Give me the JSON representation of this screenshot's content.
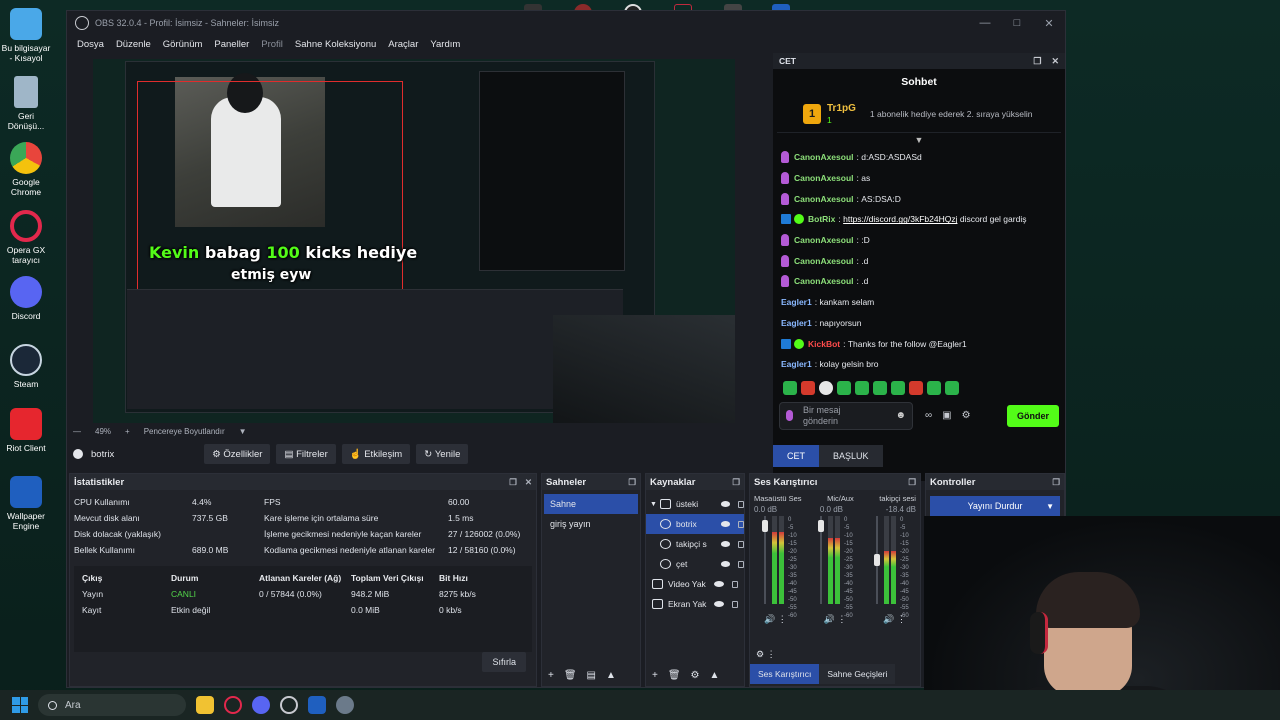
{
  "desktop": {
    "icons": [
      {
        "label": "Bu bilgisayar - Kısayol",
        "icon": "computer-icon",
        "color": "#4aa8e8"
      },
      {
        "label": "Geri Dönüşü...",
        "icon": "recycle-bin-icon",
        "color": "#9fb6c8"
      },
      {
        "label": "Google Chrome",
        "icon": "chrome-icon",
        "color": "#e8453c"
      },
      {
        "label": "Opera GX tarayıcı",
        "icon": "opera-gx-icon",
        "color": "#e2284c"
      },
      {
        "label": "Discord",
        "icon": "discord-icon",
        "color": "#5865f2"
      },
      {
        "label": "Steam",
        "icon": "steam-icon",
        "color": "#1b2838"
      },
      {
        "label": "Riot Client",
        "icon": "riot-client-icon",
        "color": "#e6262e"
      },
      {
        "label": "Wallpaper Engine",
        "icon": "wallpaper-engine-icon",
        "color": "#1f5fbf"
      }
    ]
  },
  "obs": {
    "title": "OBS 32.0.4 - Profil: İsimsiz - Sahneler: İsimsiz",
    "menu": [
      "Dosya",
      "Düzenle",
      "Görünüm",
      "Paneller",
      "Profil",
      "Sahne Koleksiyonu",
      "Araçlar",
      "Yardım"
    ],
    "preview_overlay": {
      "line1_name": "Kevin",
      "line1_mid": "babag",
      "line1_num": "100",
      "line1_end": "kicks hediye",
      "line2": "etmiş eyw"
    },
    "preview_status": {
      "zoom": "49%",
      "plus": "+",
      "fit_label": "Pencereye Boyutlandır"
    },
    "source_toolbar": {
      "source_name": "botrix",
      "properties": "Özellikler",
      "filters": "Filtreler",
      "interact": "Etkileşim",
      "refresh": "Yenile"
    }
  },
  "chat": {
    "dock_title": "CET",
    "title": "Sohbet",
    "pinned": {
      "rank": "1",
      "user": "Tr1pG",
      "count": "1",
      "message": "1 abonelik hediye ederek 2. sıraya yükselin"
    },
    "messages": [
      {
        "user": "CanonAxesoul",
        "text": "d:ASD:ASDASd",
        "kind": "sub"
      },
      {
        "user": "CanonAxesoul",
        "text": "as",
        "kind": "sub"
      },
      {
        "user": "CanonAxesoul",
        "text": "AS:DSA:D",
        "kind": "sub"
      },
      {
        "user": "BotRix",
        "text": "discord gel gardiş",
        "link": "https://discord.gg/3kFb24HQzj",
        "kind": "bot"
      },
      {
        "user": "CanonAxesoul",
        "text": ":D",
        "kind": "sub"
      },
      {
        "user": "CanonAxesoul",
        "text": ".d",
        "kind": "sub"
      },
      {
        "user": "CanonAxesoul",
        "text": ".d",
        "kind": "sub"
      },
      {
        "user": "Eagler1",
        "text": "kankam selam",
        "kind": "plain"
      },
      {
        "user": "Eagler1",
        "text": "napıyorsun",
        "kind": "plain"
      },
      {
        "user": "KickBot",
        "text": "Thanks for the follow @Eagler1",
        "kind": "kickbot"
      },
      {
        "user": "Eagler1",
        "text": "kolay gelsin bro",
        "kind": "plain"
      }
    ],
    "input_placeholder": "Bir mesaj gönderin",
    "send_label": "Gönder",
    "tabs": [
      "CET",
      "BAŞLUK"
    ]
  },
  "stats": {
    "title": "İstatistikler",
    "rows": [
      [
        "CPU Kullanımı",
        "4.4%",
        "FPS",
        "60.00"
      ],
      [
        "Mevcut disk alanı",
        "737.5 GB",
        "Kare işleme için ortalama süre",
        "1.5 ms"
      ],
      [
        "Disk dolacak (yaklaşık)",
        "",
        "İşleme gecikmesi nedeniyle kaçan kareler",
        "27 / 126002 (0.0%)"
      ],
      [
        "Bellek Kullanımı",
        "689.0 MB",
        "Kodlama gecikmesi nedeniyle atlanan kareler",
        "12 / 58160 (0.0%)"
      ]
    ],
    "output_headers": [
      "Çıkış",
      "Durum",
      "Atlanan Kareler (Ağ)",
      "Toplam Veri Çıkışı",
      "Bit Hızı"
    ],
    "output_rows": [
      [
        "Yayın",
        "CANLI",
        "0 / 57844 (0.0%)",
        "948.2 MiB",
        "8275 kb/s"
      ],
      [
        "Kayıt",
        "Etkin değil",
        "",
        "0.0 MiB",
        "0 kb/s"
      ]
    ],
    "reset_label": "Sıfırla"
  },
  "scenes": {
    "title": "Sahneler",
    "items": [
      "Sahne",
      "giriş yayın"
    ]
  },
  "sources": {
    "title": "Kaynaklar",
    "items": [
      {
        "label": "üsteki",
        "icon": "folder-icon"
      },
      {
        "label": "botrix",
        "icon": "browser-icon"
      },
      {
        "label": "takipçi s",
        "icon": "browser-icon"
      },
      {
        "label": "çet",
        "icon": "browser-icon"
      },
      {
        "label": "Video Yak",
        "icon": "camera-icon"
      },
      {
        "label": "Ekran Yak",
        "icon": "display-icon"
      }
    ]
  },
  "mixer": {
    "title": "Ses Karıştırıcı",
    "channels": [
      {
        "name": "Masaüstü Ses",
        "db": "0.0 dB",
        "level": 0.82
      },
      {
        "name": "Mic/Aux",
        "db": "0.0 dB",
        "level": 0.75
      },
      {
        "name": "takipçi sesi",
        "db": "-18.4 dB",
        "level": 0.6
      }
    ],
    "scale": [
      "0",
      "-5",
      "-10",
      "-15",
      "-20",
      "-25",
      "-30",
      "-35",
      "-40",
      "-45",
      "-50",
      "-55",
      "-60"
    ],
    "tabs": [
      "Ses Karıştırıcı",
      "Sahne Geçişleri"
    ]
  },
  "controls": {
    "title": "Kontroller",
    "stop_stream": "Yayını Durdur"
  },
  "taskbar": {
    "search_placeholder": "Ara"
  }
}
